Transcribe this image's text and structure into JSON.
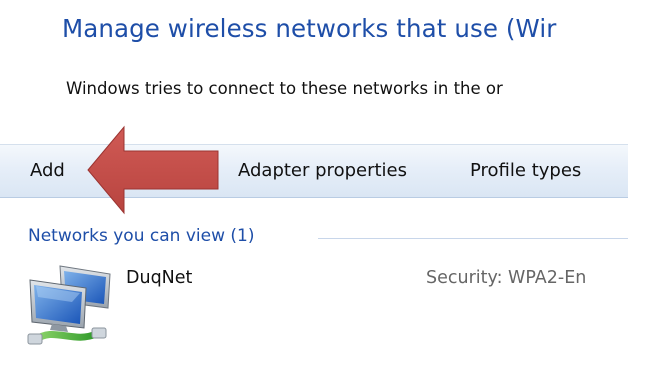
{
  "header": {
    "title": "Manage wireless networks that use (Wir",
    "subtitle": "Windows tries to connect to these networks in the or"
  },
  "toolbar": {
    "add_label": "Add",
    "adapter_label": "Adapter properties",
    "profile_label": "Profile types"
  },
  "networks": {
    "group_label": "Networks you can view (1)",
    "items": [
      {
        "name": "DuqNet",
        "security": "Security:  WPA2-En",
        "icon": "network-computers-icon"
      }
    ]
  },
  "annotation": {
    "icon": "red-arrow-icon",
    "color": "#c0504d"
  },
  "colors": {
    "title": "#1e4ea8",
    "toolbar": "#e6eef8",
    "arrow": "#c0504d"
  }
}
